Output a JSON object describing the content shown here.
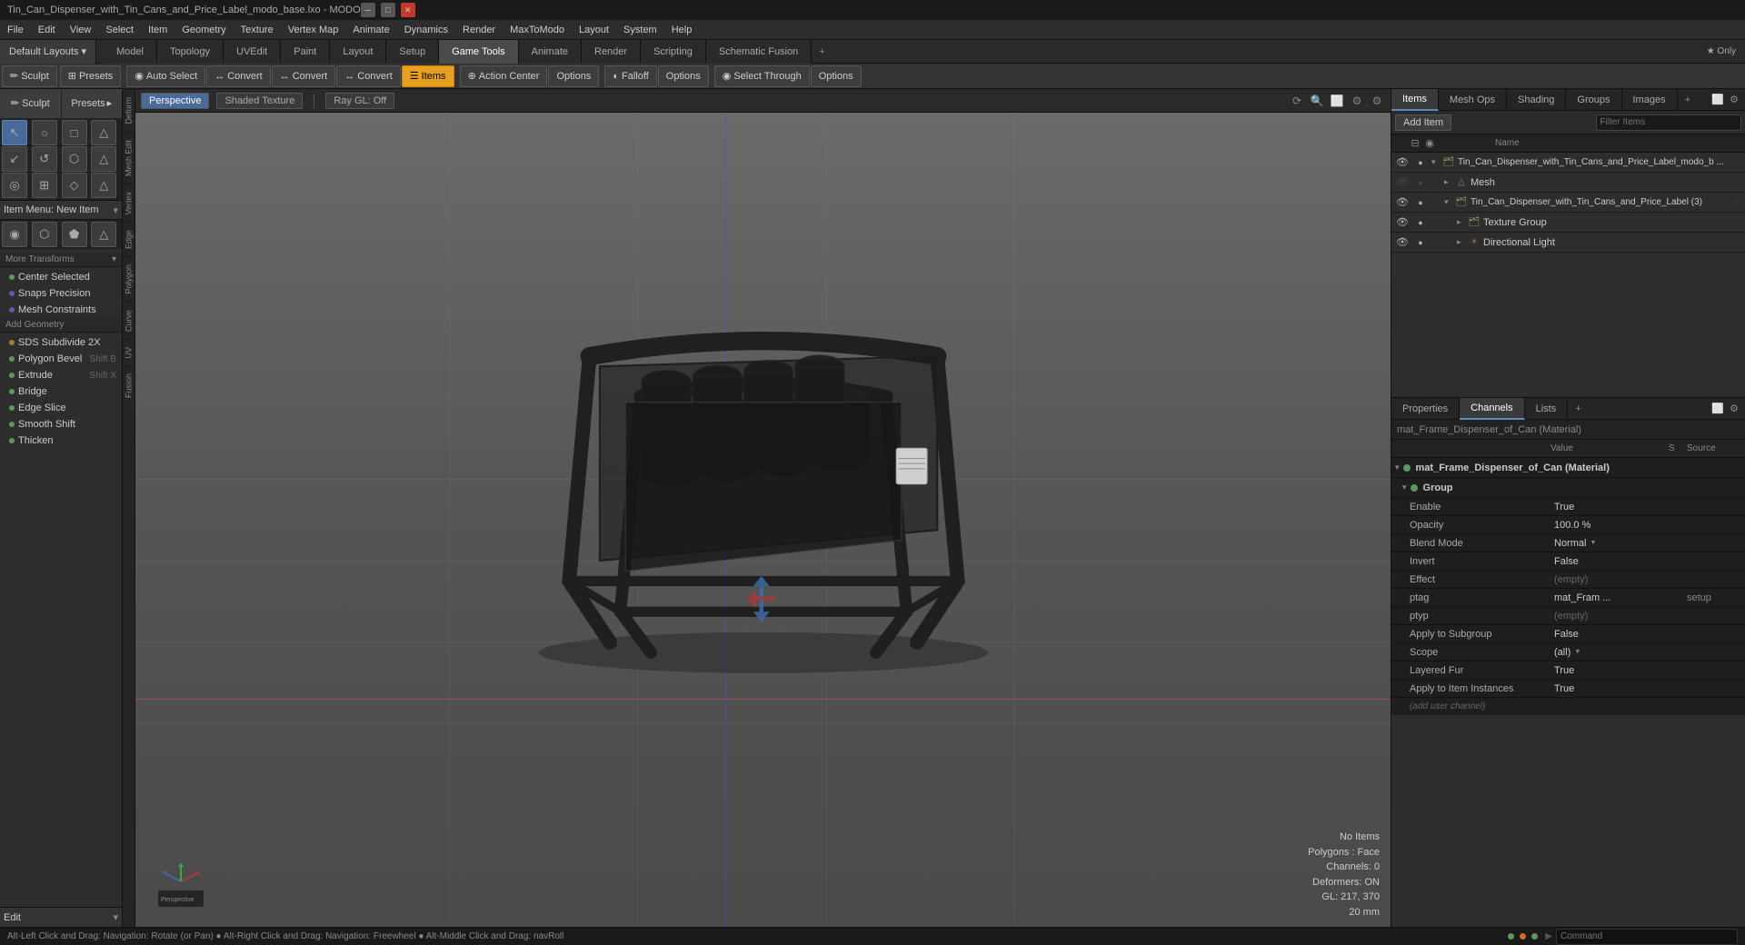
{
  "window": {
    "title": "Tin_Can_Dispenser_with_Tin_Cans_and_Price_Label_modo_base.lxo - MODO"
  },
  "titlebar": {
    "minimize": "─",
    "maximize": "□",
    "close": "✕"
  },
  "menubar": {
    "items": [
      "File",
      "Edit",
      "View",
      "Select",
      "Item",
      "Geometry",
      "Texture",
      "Vertex Map",
      "Animate",
      "Dynamics",
      "Render",
      "MaxToModo",
      "Layout",
      "System",
      "Help"
    ]
  },
  "toolbar1": {
    "tabs": [
      "Model",
      "Topology",
      "UVEdit",
      "Paint",
      "Layout",
      "Setup",
      "Game Tools",
      "Animate",
      "Render",
      "Scripting",
      "Schematic Fusion"
    ],
    "active_tab": "Game Tools",
    "plus_label": "+",
    "star_label": "★ Only"
  },
  "toolbar2": {
    "left_group": [
      {
        "label": "Sculpt",
        "icon": "✏",
        "active": false
      },
      {
        "label": "Presets",
        "icon": "⊞",
        "active": false
      }
    ],
    "auto_select": {
      "label": "Auto Select",
      "icon": "◉",
      "active": false
    },
    "convert_buttons": [
      {
        "label": "Convert",
        "icon": "↔"
      },
      {
        "label": "Convert",
        "icon": "↔"
      },
      {
        "label": "Convert",
        "icon": "↔"
      }
    ],
    "items_btn": {
      "label": "Items",
      "icon": "☰",
      "active": true
    },
    "action_center": {
      "label": "Action Center",
      "icon": "⊕",
      "active": false
    },
    "options1": {
      "label": "Options"
    },
    "falloff": {
      "label": "Falloff",
      "icon": "◐"
    },
    "options2": {
      "label": "Options"
    },
    "select_through": {
      "label": "Select Through",
      "icon": "◉"
    },
    "options3": {
      "label": "Options"
    }
  },
  "left_panel": {
    "sculpt_label": "Sculpt",
    "presets_label": "Presets",
    "tool_icons_row1": [
      "◉",
      "○",
      "□",
      "△"
    ],
    "tool_icons_row2": [
      "↙",
      "↺",
      "⬡",
      "△"
    ],
    "tool_icons_row3": [
      "◎",
      "⊞",
      "⬟",
      "△"
    ],
    "item_menu": "Item Menu: New Item",
    "tool_icons_row4": [
      "◉",
      "⬡",
      "⬟",
      "△"
    ],
    "more_transforms": "More Transforms",
    "center_selected": "Center Selected",
    "snaps_precision": "Snaps Precision",
    "mesh_constraints": "Mesh Constraints",
    "add_geometry": "Add Geometry",
    "sds_subdivide_2x": {
      "label": "SDS Subdivide 2X",
      "shortcut": ""
    },
    "polygon_bevel": {
      "label": "Polygon Bevel",
      "shortcut": "Shift B"
    },
    "extrude": {
      "label": "Extrude",
      "shortcut": "Shift X"
    },
    "bridge": {
      "label": "Bridge"
    },
    "edge_slice": {
      "label": "Edge Slice"
    },
    "smooth_shift": {
      "label": "Smooth Shift"
    },
    "thicken": {
      "label": "Thicken"
    },
    "edit_label": "Edit"
  },
  "side_tabs_left": [
    "Deform",
    "Deform",
    "Mesh Edit",
    "Vertex",
    "Edge",
    "Polygon",
    "Curve",
    "UV",
    "Fusion"
  ],
  "viewport": {
    "mode_buttons": [
      "Perspective",
      "Shaded Texture",
      "Ray GL: Off"
    ],
    "active_mode": "Perspective",
    "vp_icons": [
      "⚙",
      "🔍",
      "□",
      "⟳",
      "⚙"
    ]
  },
  "viewport_status": {
    "no_items": "No Items",
    "polygons": "Polygons : Face",
    "channels": "Channels: 0",
    "deformers": "Deformers: ON",
    "gl_info": "GL: 217, 370",
    "zoom": "20 mm"
  },
  "right_panel": {
    "tabs": [
      "Items",
      "Mesh Ops",
      "Shading",
      "Groups",
      "Images"
    ],
    "active_tab": "Items",
    "items_toolbar": {
      "add_item": "Add Item",
      "filter": "Filter Items"
    },
    "columns": {
      "name": "Name"
    },
    "tree": [
      {
        "id": "root",
        "label": "Tin_Can_Dispenser_with_Tin_Cans_and_Price_Label_modo_b ...",
        "type": "group",
        "indent": 0,
        "expanded": true,
        "visible": true,
        "children": [
          {
            "id": "mesh",
            "label": "Mesh",
            "type": "mesh",
            "indent": 1,
            "expanded": false,
            "visible": true
          },
          {
            "id": "tin_can",
            "label": "Tin_Can_Dispenser_with_Tin_Cans_and_Price_Label (3)",
            "type": "group",
            "indent": 1,
            "expanded": true,
            "visible": true,
            "children": [
              {
                "id": "texture_group",
                "label": "Texture Group",
                "type": "group",
                "indent": 2,
                "visible": true
              },
              {
                "id": "directional_light",
                "label": "Directional Light",
                "type": "light",
                "indent": 2,
                "visible": true
              }
            ]
          }
        ]
      }
    ]
  },
  "properties_panel": {
    "tabs": [
      "Properties",
      "Channels",
      "Lists"
    ],
    "active_tab": "Channels",
    "plus_label": "+",
    "material_title": "mat_Frame_Dispenser_of_Can (Material)",
    "columns": {
      "name": "",
      "value": "Value",
      "s": "S",
      "source": "Source"
    },
    "groups": [
      {
        "label": "mat_Frame_Dispenser_of_Can (Material)",
        "dot_color": "#5a9a5a",
        "expanded": true
      },
      {
        "label": "Group",
        "dot_color": "#5a9a5a",
        "expanded": true,
        "properties": [
          {
            "name": "Enable",
            "value": "True",
            "s": "",
            "source": ""
          },
          {
            "name": "Opacity",
            "value": "100.0 %",
            "s": "",
            "source": ""
          },
          {
            "name": "Blend Mode",
            "value": "Normal",
            "s": "",
            "source": "",
            "dropdown": true
          },
          {
            "name": "Invert",
            "value": "False",
            "s": "",
            "source": ""
          },
          {
            "name": "Effect",
            "value": "(empty)",
            "s": "",
            "source": ""
          },
          {
            "name": "ptag",
            "value": "mat_Fram ...",
            "s": "",
            "source": "setup"
          },
          {
            "name": "ptyp",
            "value": "(empty)",
            "s": "",
            "source": ""
          },
          {
            "name": "Apply to Subgroup",
            "value": "False",
            "s": "",
            "source": ""
          },
          {
            "name": "Scope",
            "value": "(all)",
            "s": "",
            "source": "",
            "dropdown": true
          },
          {
            "name": "Layered Fur",
            "value": "True",
            "s": "",
            "source": ""
          },
          {
            "name": "Apply to Item Instances",
            "value": "True",
            "s": "",
            "source": ""
          }
        ],
        "add_channel": "(add user channel)"
      }
    ]
  },
  "statusbar": {
    "text": "Alt-Left Click and Drag: Navigation: Rotate (or Pan) ● Alt-Right Click and Drag: Navigation: Freewheel ● Alt-Middle Click and Drag: navRoll",
    "command_placeholder": "Command"
  }
}
